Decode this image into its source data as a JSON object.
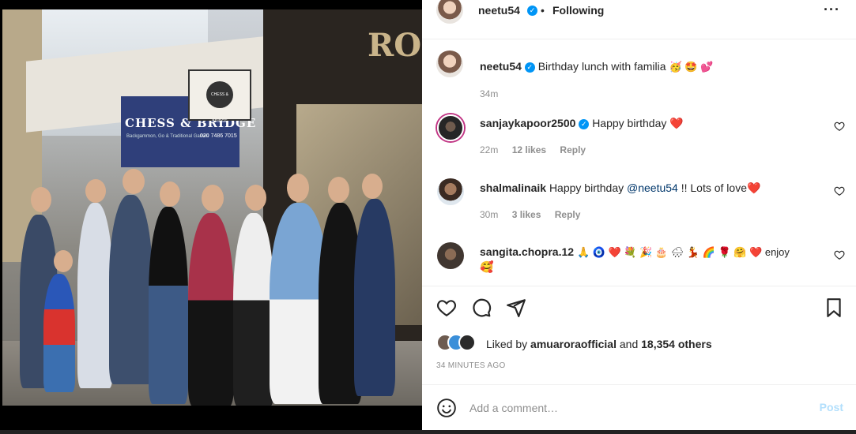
{
  "post": {
    "author": "neetu54",
    "follow_status": "Following",
    "more_icon": "more-options-icon"
  },
  "media": {
    "sign_text": "CHESS & BRIDGE",
    "sign_subtext": "Backgammon, Go & Traditional Games",
    "sign_phone": "020 7486 7015",
    "hanging_sign_text": "CHESS & BRIDGE",
    "storefront_letters": "RO"
  },
  "caption": {
    "username": "neetu54",
    "text": "Birthday lunch with familia",
    "emojis": "🥳 🤩 💕",
    "time": "34m"
  },
  "comments": [
    {
      "username": "sanjaykapoor2500",
      "verified": true,
      "text": "Happy birthday ❤️",
      "time": "22m",
      "likes": "12 likes",
      "reply": "Reply"
    },
    {
      "username": "shalmalinaik",
      "verified": false,
      "text_before": "Happy birthday ",
      "mention": "@neetu54",
      "text_after": " !! Lots of love❤️",
      "time": "30m",
      "likes": "3 likes",
      "reply": "Reply"
    },
    {
      "username": "sangita.chopra.12",
      "verified": false,
      "text": "🙏 🧿 ❤️ 💐 🎉 🎂 🌧 💃 🌈 🌹 🤗 ❤️ enjoy",
      "text_line2": "🥰"
    }
  ],
  "actions": {
    "liked_by_prefix": "Liked by ",
    "liked_by_user": "amuaroraofficial",
    "liked_by_suffix": " and ",
    "others_count": "18,354 others",
    "time_ago": "34 MINUTES AGO"
  },
  "composer": {
    "placeholder": "Add a comment…",
    "post_label": "Post"
  },
  "colors": {
    "verified": "#0095f6",
    "post_button_disabled": "#b2dffc",
    "mention": "#00376b",
    "meta_gray": "#8e8e8e"
  }
}
